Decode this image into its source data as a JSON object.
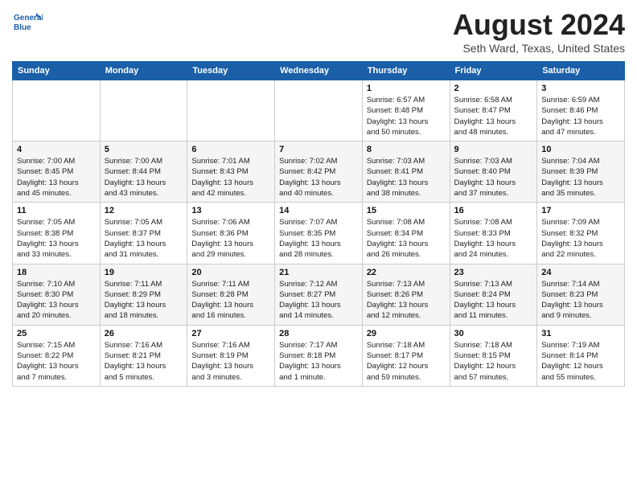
{
  "header": {
    "logo_line1": "General",
    "logo_line2": "Blue",
    "month": "August 2024",
    "location": "Seth Ward, Texas, United States"
  },
  "weekdays": [
    "Sunday",
    "Monday",
    "Tuesday",
    "Wednesday",
    "Thursday",
    "Friday",
    "Saturday"
  ],
  "weeks": [
    [
      {
        "day": "",
        "info": ""
      },
      {
        "day": "",
        "info": ""
      },
      {
        "day": "",
        "info": ""
      },
      {
        "day": "",
        "info": ""
      },
      {
        "day": "1",
        "info": "Sunrise: 6:57 AM\nSunset: 8:48 PM\nDaylight: 13 hours\nand 50 minutes."
      },
      {
        "day": "2",
        "info": "Sunrise: 6:58 AM\nSunset: 8:47 PM\nDaylight: 13 hours\nand 48 minutes."
      },
      {
        "day": "3",
        "info": "Sunrise: 6:59 AM\nSunset: 8:46 PM\nDaylight: 13 hours\nand 47 minutes."
      }
    ],
    [
      {
        "day": "4",
        "info": "Sunrise: 7:00 AM\nSunset: 8:45 PM\nDaylight: 13 hours\nand 45 minutes."
      },
      {
        "day": "5",
        "info": "Sunrise: 7:00 AM\nSunset: 8:44 PM\nDaylight: 13 hours\nand 43 minutes."
      },
      {
        "day": "6",
        "info": "Sunrise: 7:01 AM\nSunset: 8:43 PM\nDaylight: 13 hours\nand 42 minutes."
      },
      {
        "day": "7",
        "info": "Sunrise: 7:02 AM\nSunset: 8:42 PM\nDaylight: 13 hours\nand 40 minutes."
      },
      {
        "day": "8",
        "info": "Sunrise: 7:03 AM\nSunset: 8:41 PM\nDaylight: 13 hours\nand 38 minutes."
      },
      {
        "day": "9",
        "info": "Sunrise: 7:03 AM\nSunset: 8:40 PM\nDaylight: 13 hours\nand 37 minutes."
      },
      {
        "day": "10",
        "info": "Sunrise: 7:04 AM\nSunset: 8:39 PM\nDaylight: 13 hours\nand 35 minutes."
      }
    ],
    [
      {
        "day": "11",
        "info": "Sunrise: 7:05 AM\nSunset: 8:38 PM\nDaylight: 13 hours\nand 33 minutes."
      },
      {
        "day": "12",
        "info": "Sunrise: 7:05 AM\nSunset: 8:37 PM\nDaylight: 13 hours\nand 31 minutes."
      },
      {
        "day": "13",
        "info": "Sunrise: 7:06 AM\nSunset: 8:36 PM\nDaylight: 13 hours\nand 29 minutes."
      },
      {
        "day": "14",
        "info": "Sunrise: 7:07 AM\nSunset: 8:35 PM\nDaylight: 13 hours\nand 28 minutes."
      },
      {
        "day": "15",
        "info": "Sunrise: 7:08 AM\nSunset: 8:34 PM\nDaylight: 13 hours\nand 26 minutes."
      },
      {
        "day": "16",
        "info": "Sunrise: 7:08 AM\nSunset: 8:33 PM\nDaylight: 13 hours\nand 24 minutes."
      },
      {
        "day": "17",
        "info": "Sunrise: 7:09 AM\nSunset: 8:32 PM\nDaylight: 13 hours\nand 22 minutes."
      }
    ],
    [
      {
        "day": "18",
        "info": "Sunrise: 7:10 AM\nSunset: 8:30 PM\nDaylight: 13 hours\nand 20 minutes."
      },
      {
        "day": "19",
        "info": "Sunrise: 7:11 AM\nSunset: 8:29 PM\nDaylight: 13 hours\nand 18 minutes."
      },
      {
        "day": "20",
        "info": "Sunrise: 7:11 AM\nSunset: 8:28 PM\nDaylight: 13 hours\nand 16 minutes."
      },
      {
        "day": "21",
        "info": "Sunrise: 7:12 AM\nSunset: 8:27 PM\nDaylight: 13 hours\nand 14 minutes."
      },
      {
        "day": "22",
        "info": "Sunrise: 7:13 AM\nSunset: 8:26 PM\nDaylight: 13 hours\nand 12 minutes."
      },
      {
        "day": "23",
        "info": "Sunrise: 7:13 AM\nSunset: 8:24 PM\nDaylight: 13 hours\nand 11 minutes."
      },
      {
        "day": "24",
        "info": "Sunrise: 7:14 AM\nSunset: 8:23 PM\nDaylight: 13 hours\nand 9 minutes."
      }
    ],
    [
      {
        "day": "25",
        "info": "Sunrise: 7:15 AM\nSunset: 8:22 PM\nDaylight: 13 hours\nand 7 minutes."
      },
      {
        "day": "26",
        "info": "Sunrise: 7:16 AM\nSunset: 8:21 PM\nDaylight: 13 hours\nand 5 minutes."
      },
      {
        "day": "27",
        "info": "Sunrise: 7:16 AM\nSunset: 8:19 PM\nDaylight: 13 hours\nand 3 minutes."
      },
      {
        "day": "28",
        "info": "Sunrise: 7:17 AM\nSunset: 8:18 PM\nDaylight: 13 hours\nand 1 minute."
      },
      {
        "day": "29",
        "info": "Sunrise: 7:18 AM\nSunset: 8:17 PM\nDaylight: 12 hours\nand 59 minutes."
      },
      {
        "day": "30",
        "info": "Sunrise: 7:18 AM\nSunset: 8:15 PM\nDaylight: 12 hours\nand 57 minutes."
      },
      {
        "day": "31",
        "info": "Sunrise: 7:19 AM\nSunset: 8:14 PM\nDaylight: 12 hours\nand 55 minutes."
      }
    ]
  ]
}
